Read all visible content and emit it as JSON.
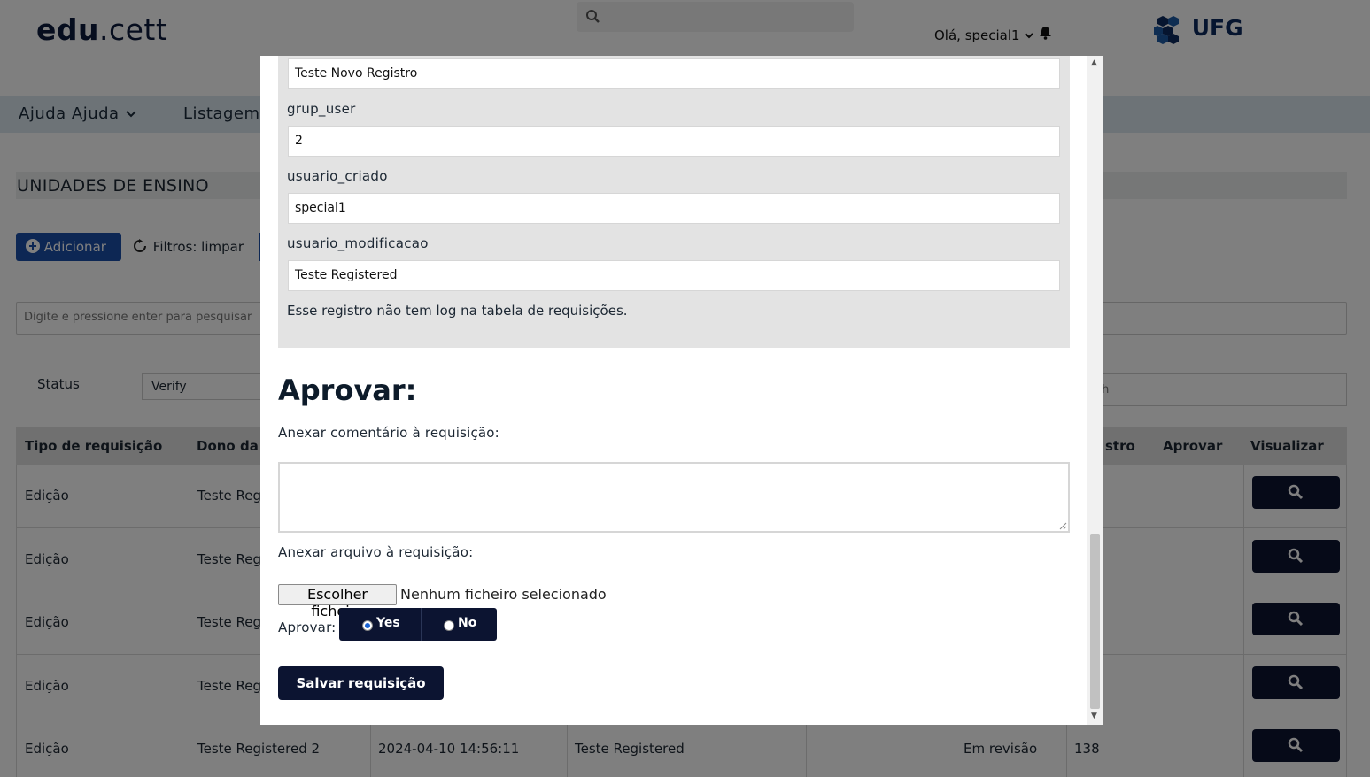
{
  "header": {
    "logo_main": "edu",
    "logo_suffix": ".cett",
    "greeting": "Olá, special1",
    "partner_logo": "UFG"
  },
  "nav": {
    "items": [
      {
        "label": "Ajuda Ajuda"
      },
      {
        "label": "Listagem"
      }
    ]
  },
  "page": {
    "title": "UNIDADES DE ENSINO",
    "add_button": "Adicionar",
    "filters_label": "Filtros: limpar",
    "search_placeholder": "Digite e pressione enter para pesquisar",
    "status_label": "Status",
    "status_value": "Verify",
    "search_right_placeholder": "ch"
  },
  "table": {
    "headers": [
      "Tipo de requisição",
      "Dono da r",
      "stro",
      "Aprovar",
      "Visualizar"
    ],
    "rows": [
      {
        "tipo": "Edição",
        "dono": "Teste Reg",
        "data": "",
        "usuario": "",
        "status": "",
        "num": ""
      },
      {
        "tipo": "Edição",
        "dono": "Teste Reg",
        "data": "",
        "usuario": "",
        "status": "",
        "num": ""
      },
      {
        "tipo": "Edição",
        "dono": "Teste Reg",
        "data": "",
        "usuario": "",
        "status": "",
        "num": ""
      },
      {
        "tipo": "Edição",
        "dono": "Teste Reg",
        "data": "",
        "usuario": "",
        "status": "",
        "num": ""
      },
      {
        "tipo": "Edição",
        "dono": "Teste Registered 2",
        "data": "2024-04-10 14:56:11",
        "usuario": "Teste Registered",
        "status": "Em revisão",
        "num": "138"
      }
    ]
  },
  "modal": {
    "fields": [
      {
        "label": "",
        "value": "Teste Novo Registro"
      },
      {
        "label": "grup_user",
        "value": "2"
      },
      {
        "label": "usuario_criado",
        "value": "special1"
      },
      {
        "label": "usuario_modificacao",
        "value": "Teste Registered"
      }
    ],
    "log_note": "Esse registro não tem log na tabela de requisições.",
    "aprovar_title": "Aprovar:",
    "comment_label": "Anexar comentário à requisição:",
    "file_label": "Anexar arquivo à requisição:",
    "file_button": "Escolher ficheiro",
    "file_status": "Nenhum ficheiro selecionado",
    "approve_label": "Aprovar:",
    "approve_yes": "Yes",
    "approve_no": "No",
    "approve_selected": "Yes",
    "save_button": "Salvar requisição"
  },
  "colors": {
    "primary_dark": "#0c1431",
    "primary_blue": "#1b4fa8",
    "nav_bg": "#dbe6ee",
    "overlay": "rgba(0,0,0,0.5)"
  }
}
